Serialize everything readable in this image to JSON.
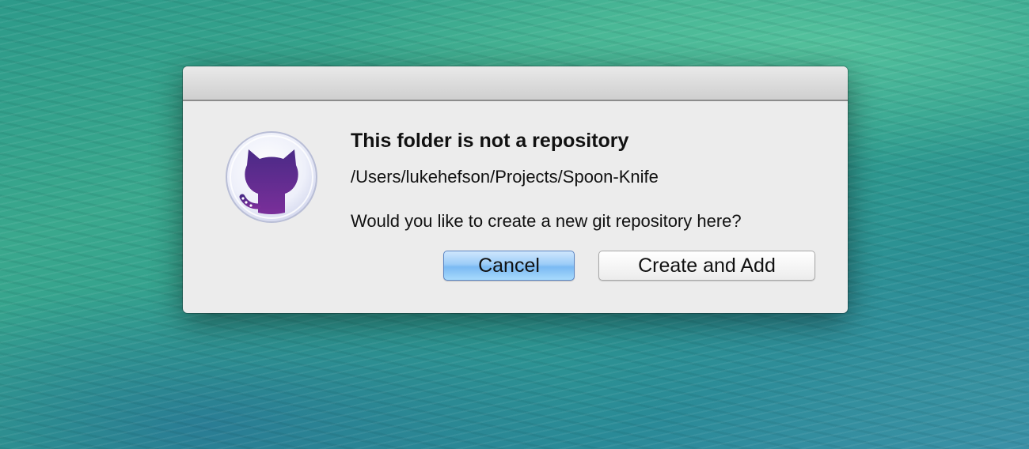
{
  "dialog": {
    "title": "This folder is not a repository",
    "path": "/Users/lukehefson/Projects/Spoon-Knife",
    "message": "Would you like to create a new git repository here?",
    "icon": "octocat-icon",
    "buttons": {
      "cancel_label": "Cancel",
      "create_label": "Create and Add"
    }
  },
  "colors": {
    "dialog_background": "#ececec",
    "icon_purple": "#5a2d8c",
    "default_button_blue": "#8fc6f6"
  }
}
